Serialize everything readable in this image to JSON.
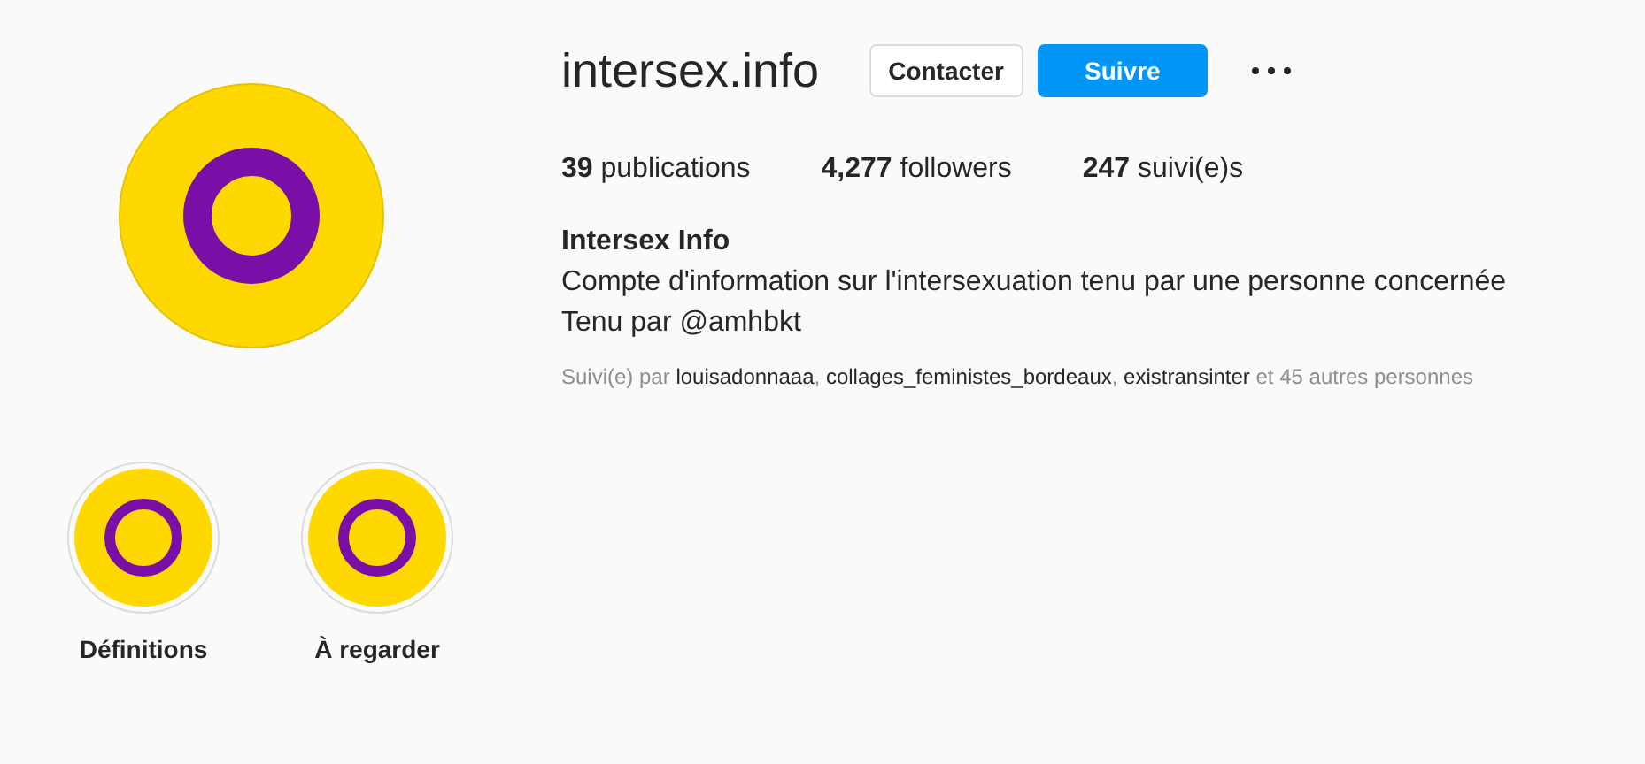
{
  "profile": {
    "username": "intersex.info",
    "buttons": [
      {
        "label": "Contacter",
        "kind": "secondary"
      },
      {
        "label": "Suivre",
        "kind": "primary"
      }
    ],
    "stats": [
      "**39** publications",
      "**4,277** followers",
      "**247** suivi(e)s"
    ],
    "name": "Intersex Info",
    "bio": [
      "Compte d'information sur l'intersexuation tenu par une personne concernée",
      "Tenu par @amhbkt"
    ],
    "followed_by": "Suivi(e) par **louisadonnaaa**, **collages_feministes_bordeaux**, **existransinter** et 45 autres personnes"
  },
  "highlights": [
    {
      "label": "Définitions"
    },
    {
      "label": "À regarder"
    }
  ]
}
